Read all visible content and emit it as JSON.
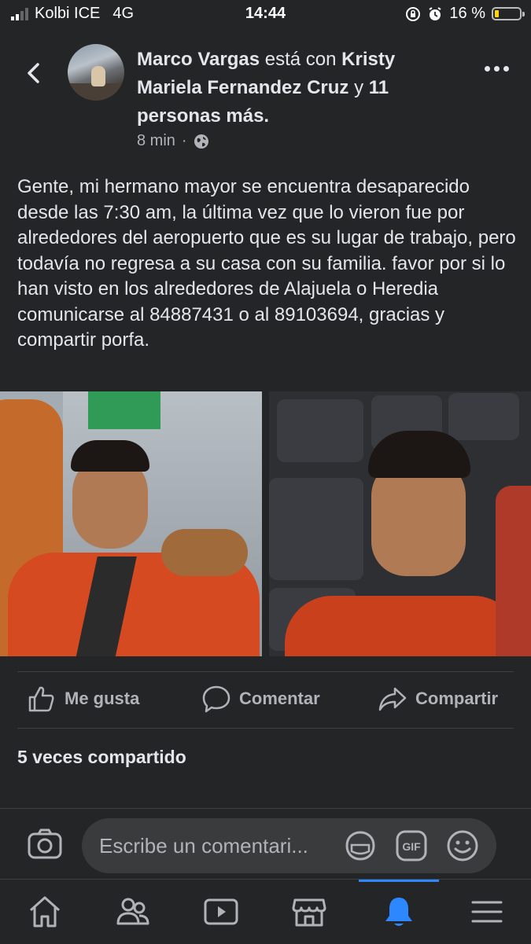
{
  "status_bar": {
    "carrier": "Kolbi ICE",
    "network": "4G",
    "time": "14:44",
    "battery_percent": "16 %",
    "battery_level": 0.16,
    "battery_color": "#ffd60a",
    "icons": [
      "signal-icon",
      "rotation-lock-icon",
      "alarm-icon",
      "battery-icon"
    ]
  },
  "post": {
    "author": "Marco Vargas",
    "with_text": "está con",
    "tagged": "Kristy Mariela Fernandez Cruz",
    "conjunction": "y",
    "others": "11 personas más.",
    "time_ago": "8 min",
    "separator": "·",
    "privacy_icon": "globe-icon",
    "text": "Gente, mi hermano mayor se encuentra desaparecido desde las 7:30 am, la última vez que lo vieron fue por alrededores del aeropuerto que es su lugar de trabajo, pero todavía no regresa a su casa con su familia. favor por si lo han visto en los alrededores de Alajuela o Heredia comunicarse al 84887431 o al 89103694, gracias y compartir porfa.",
    "shares": "5 veces compartido"
  },
  "actions": {
    "like": "Me gusta",
    "comment": "Comentar",
    "share": "Compartir"
  },
  "comment_box": {
    "placeholder": "Escribe un comentari..."
  },
  "nav": {
    "items": [
      "home-icon",
      "friends-icon",
      "watch-icon",
      "marketplace-icon",
      "notifications-icon",
      "menu-icon"
    ],
    "active": "notifications-icon",
    "accent": "#2d88ff"
  },
  "colors": {
    "background": "#242526",
    "text": "#e4e6eb",
    "secondary_text": "#b0b3b8"
  }
}
